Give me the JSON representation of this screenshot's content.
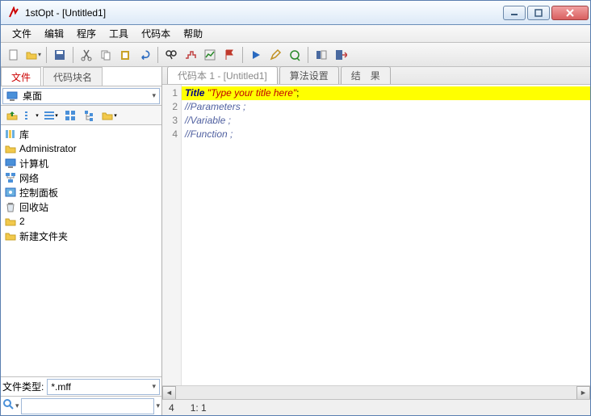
{
  "window": {
    "title": "1stOpt - [Untitled1]"
  },
  "menu": {
    "file": "文件",
    "edit": "编辑",
    "program": "程序",
    "tools": "工具",
    "codebook": "代码本",
    "help": "帮助"
  },
  "sidebar": {
    "tabs": {
      "file": "文件",
      "codeblock": "代码块名"
    },
    "location": "桌面",
    "tree": {
      "lib": "库",
      "admin": "Administrator",
      "computer": "计算机",
      "network": "网络",
      "control": "控制面板",
      "recycle": "回收站",
      "two": "2",
      "newfolder": "新建文件夹"
    },
    "filetype_label": "文件类型:",
    "filetype_value": "*.mff"
  },
  "editor": {
    "tabs": {
      "code": "代码本 1 - [Untitled1]",
      "algo": "算法设置",
      "result": "结　果"
    },
    "lines": {
      "l1_kw": "Title ",
      "l1_str": "\"Type your title here\"",
      "l1_end": ";",
      "l2": "//Parameters ;",
      "l3": "//Variable ;",
      "l4": "//Function ;"
    },
    "gut": {
      "g1": "1",
      "g2": "2",
      "g3": "3",
      "g4": "4"
    }
  },
  "status": {
    "line": "4",
    "pos": "1: 1"
  }
}
